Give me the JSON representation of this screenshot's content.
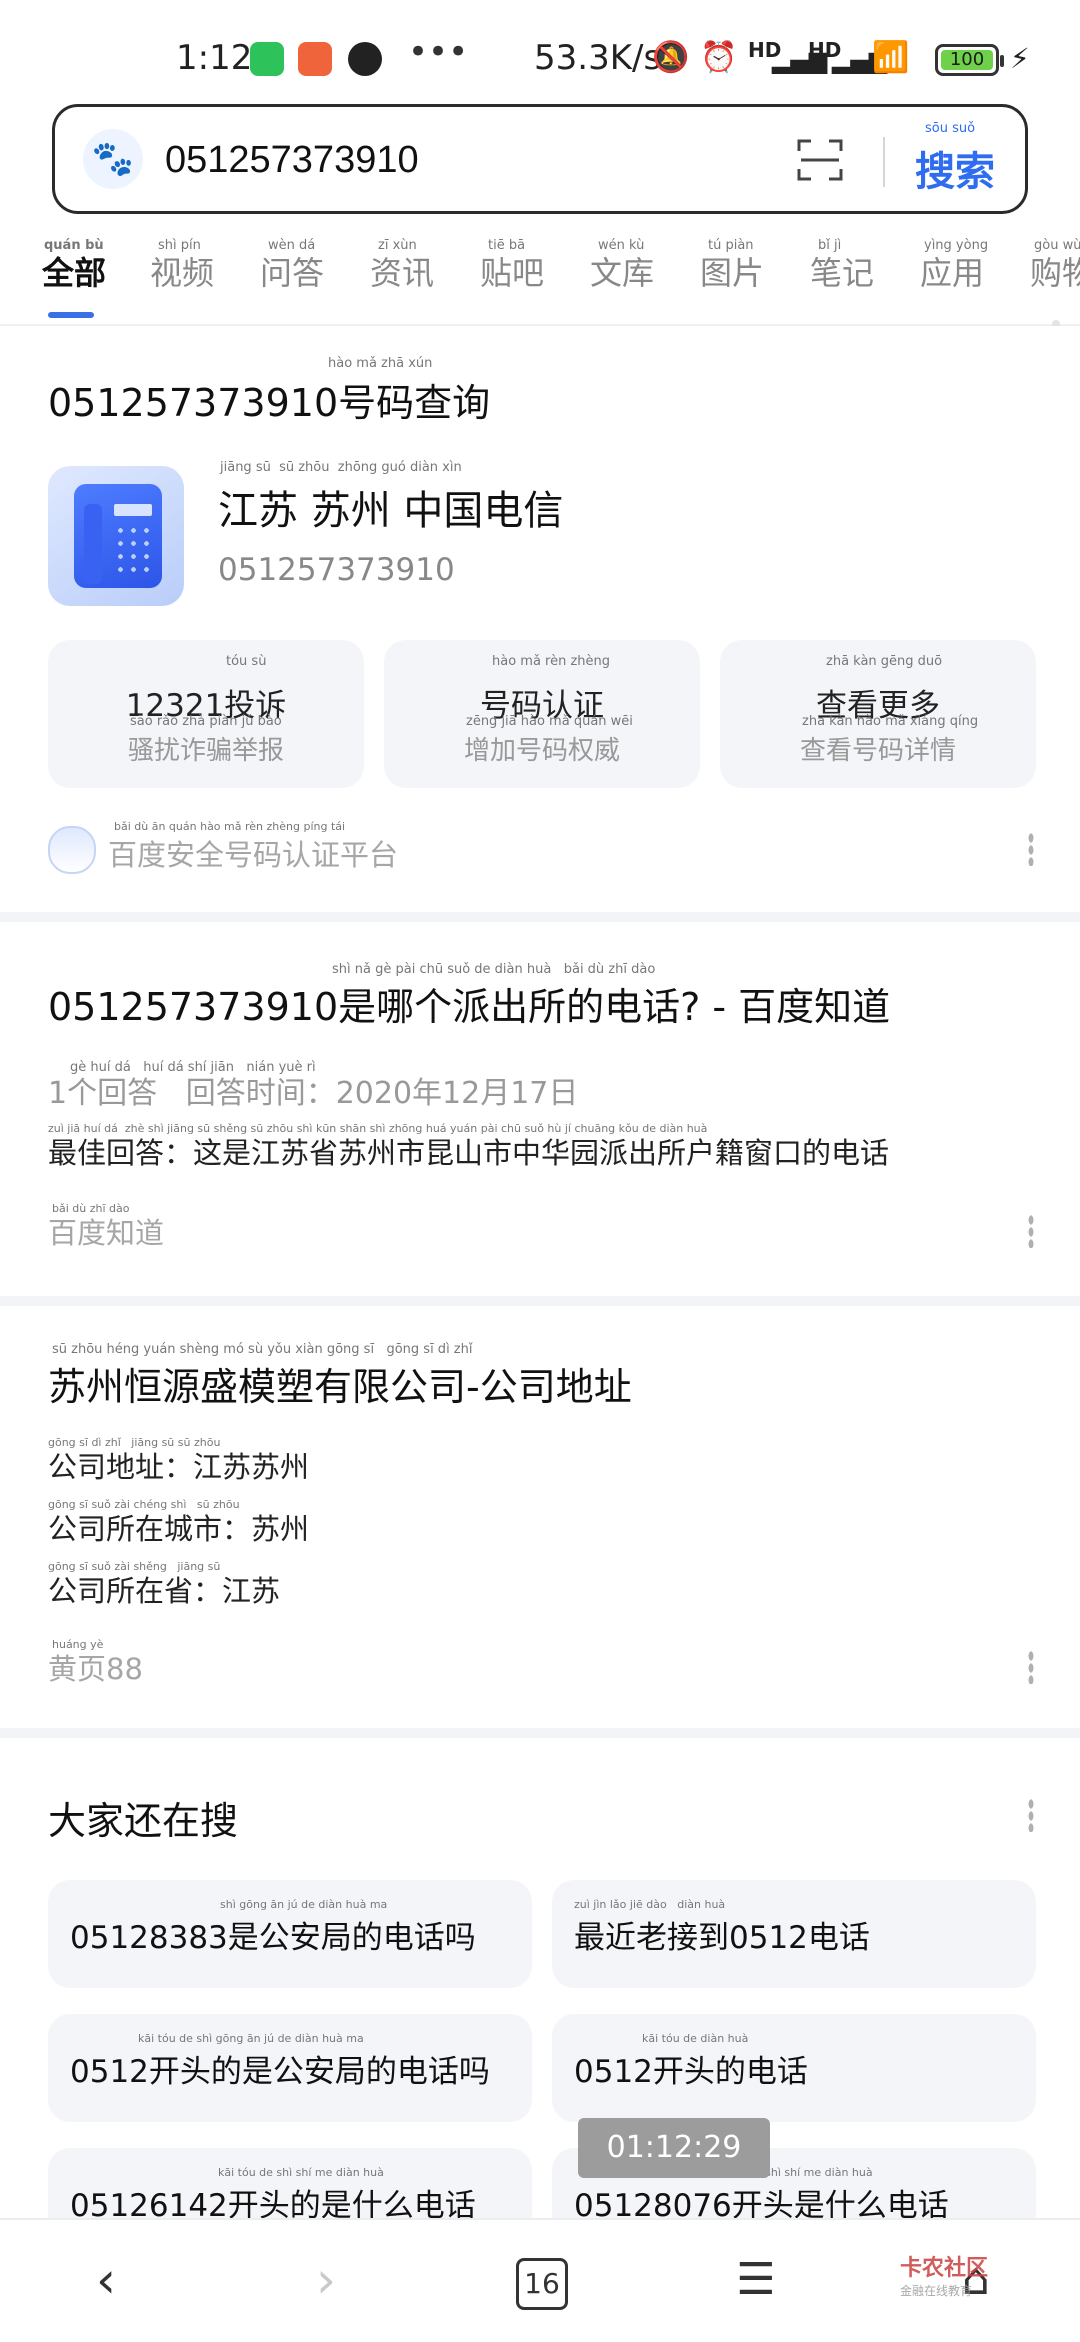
{
  "status_bar": {
    "time": "1:12",
    "speed": "53.3K/s",
    "signal1": "HD",
    "signal2": "HD",
    "battery": "100"
  },
  "search": {
    "value": "051257373910",
    "button_label": "搜索",
    "button_pinyin": "sōu suǒ"
  },
  "tabs": [
    {
      "label": "全部",
      "pinyin": "quán bù"
    },
    {
      "label": "视频",
      "pinyin": "shì pín"
    },
    {
      "label": "问答",
      "pinyin": "wèn dá"
    },
    {
      "label": "资讯",
      "pinyin": "zī xùn"
    },
    {
      "label": "贴吧",
      "pinyin": "tiē bā"
    },
    {
      "label": "文库",
      "pinyin": "wén kù"
    },
    {
      "label": "图片",
      "pinyin": "tú piàn"
    },
    {
      "label": "笔记",
      "pinyin": "bǐ jì"
    },
    {
      "label": "应用",
      "pinyin": "yìng yòng"
    },
    {
      "label": "购物",
      "pinyin": "gòu wù"
    }
  ],
  "card1": {
    "title_number": "051257373910",
    "title_suffix": "号码查询",
    "title_pinyin": "hào mǎ zhā xún",
    "location": "江苏 苏州 中国电信",
    "location_pinyin": "jiāng sū  sū zhōu  zhōng guó diàn xìn",
    "number": "051257373910",
    "actions": [
      {
        "title": "12321投诉",
        "title_pinyin": "tóu sù",
        "sub": "骚扰诈骗举报",
        "sub_pinyin": "sāo rǎo zhà piàn jǔ bào"
      },
      {
        "title": "号码认证",
        "title_pinyin": "hào mǎ rèn zhèng",
        "sub": "增加号码权威",
        "sub_pinyin": "zēng jiā hào mǎ quán wēi"
      },
      {
        "title": "查看更多",
        "title_pinyin": "zhā kàn gēng duō",
        "sub": "查看号码详情",
        "sub_pinyin": "zhā kàn hào mǎ xiáng qíng"
      }
    ],
    "source": "百度安全号码认证平台",
    "source_pinyin": "bǎi dù ān quán hào mǎ rèn zhèng píng tái"
  },
  "card2": {
    "title_number": "051257373910",
    "title_suffix": "是哪个派出所的电话? - 百度知道",
    "title_pinyin": "shì nǎ gè pài chū suǒ de diàn huà   bǎi dù zhī dào",
    "meta": "1个回答   回答时间：2020年12月17日",
    "meta_pinyin": "gè huí dá   huí dá shí jiān   nián yuè rì",
    "answer": "最佳回答：这是江苏省苏州市昆山市中华园派出所户籍窗口的电话",
    "answer_pinyin": "zuì jiā huí dá  zhè shì jiāng sū shěng sū zhōu shì kūn shān shì zhōng huá yuán pài chū suǒ hù jí chuāng kǒu de diàn huà",
    "source": "百度知道",
    "source_pinyin": "bǎi dù zhī dào"
  },
  "card3": {
    "title": "苏州恒源盛模塑有限公司-公司地址",
    "title_pinyin": "sū zhōu héng yuán shèng mó sù yǒu xiàn gōng sī   gōng sī dì zhǐ",
    "lines": [
      {
        "text": "公司地址：江苏苏州",
        "pinyin": "gōng sī dì zhǐ   jiāng sū sū zhōu"
      },
      {
        "text": "公司所在城市：苏州",
        "pinyin": "gōng sī suǒ zài chéng shì   sū zhōu"
      },
      {
        "text": "公司所在省：江苏",
        "pinyin": "gōng sī suǒ zài shěng   jiāng sū"
      }
    ],
    "source": "黄页88",
    "source_pinyin": "huáng yè"
  },
  "card4": {
    "title": "大家还在搜",
    "chips": [
      {
        "text": "05128383是公安局的电话吗",
        "pinyin": "shì gōng ān jú de diàn huà ma"
      },
      {
        "text": "最近老接到0512电话",
        "pinyin": "zuì jìn lǎo jiē dào   diàn huà"
      },
      {
        "text": "0512开头的是公安局的电话吗",
        "pinyin": "kāi tóu de shì gōng ān jú de diàn huà ma"
      },
      {
        "text": "0512开头的电话",
        "pinyin": "kāi tóu de diàn huà"
      },
      {
        "text": "05126142开头的是什么电话",
        "pinyin": "kāi tóu de shì shí me diàn huà"
      },
      {
        "text": "05128076开头是什么电话",
        "pinyin": "kāi tóu shì shí me diàn huà"
      }
    ]
  },
  "toast": "01:12:29",
  "bottom_nav": {
    "tab_count": "16",
    "watermark_line1": "卡农社区",
    "watermark_line2": "金融在线教育"
  },
  "colors": {
    "accent": "#2f6df0",
    "number_red": "#d23c3c",
    "card_bg": "#f3f5f9"
  }
}
